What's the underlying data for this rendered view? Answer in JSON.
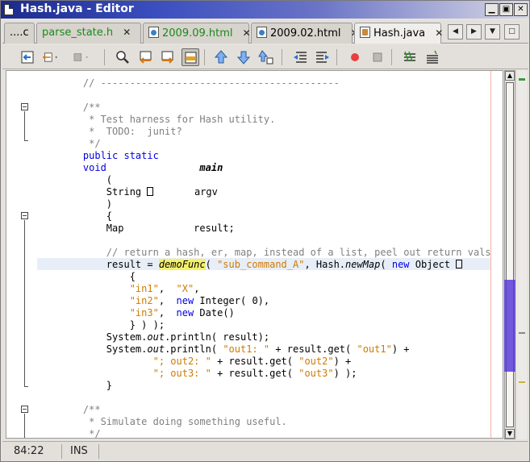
{
  "window": {
    "title": "Hash.java - Editor"
  },
  "window_buttons": [
    "minimize",
    "maximize",
    "close"
  ],
  "tabs": [
    {
      "label": "....c",
      "icon": "none",
      "active": false
    },
    {
      "label": "parse_state.h",
      "icon": "none",
      "active": false,
      "color": "#1a8a1a"
    },
    {
      "label": "2009.09.html",
      "icon": "html-file-icon",
      "active": false,
      "color": "#1a8a1a"
    },
    {
      "label": "2009.02.html",
      "icon": "html-file-icon",
      "active": false
    },
    {
      "label": "Hash.java",
      "icon": "java-file-icon",
      "active": true
    }
  ],
  "tab_close_glyph": "✕",
  "editor": {
    "lines": [
      {
        "parts": [
          {
            "t": "    "
          },
          {
            "c": "cm",
            "t": "// -----------------------------------------"
          }
        ]
      },
      {
        "parts": [
          {
            "t": ""
          }
        ]
      },
      {
        "parts": [
          {
            "t": "    "
          },
          {
            "c": "cm",
            "t": "/**"
          }
        ]
      },
      {
        "parts": [
          {
            "t": "     "
          },
          {
            "c": "cm",
            "t": "* Test harness for Hash utility."
          }
        ]
      },
      {
        "parts": [
          {
            "t": "     "
          },
          {
            "c": "cm",
            "t": "*  TODO:  junit?"
          }
        ]
      },
      {
        "parts": [
          {
            "t": "     "
          },
          {
            "c": "cm",
            "t": "*/"
          }
        ]
      },
      {
        "parts": [
          {
            "t": "    "
          },
          {
            "c": "kw",
            "t": "public static"
          }
        ]
      },
      {
        "parts": [
          {
            "t": "    "
          },
          {
            "c": "kw",
            "t": "void"
          },
          {
            "t": "                "
          },
          {
            "c": "bi",
            "t": "main"
          }
        ]
      },
      {
        "parts": [
          {
            "t": "        ("
          }
        ]
      },
      {
        "parts": [
          {
            "t": "        String "
          },
          {
            "c": "box",
            "t": ""
          },
          {
            "t": "       argv"
          }
        ]
      },
      {
        "parts": [
          {
            "t": "        )"
          }
        ]
      },
      {
        "parts": [
          {
            "t": "        {"
          }
        ]
      },
      {
        "parts": [
          {
            "t": "        Map            result;"
          }
        ]
      },
      {
        "parts": [
          {
            "t": ""
          }
        ]
      },
      {
        "parts": [
          {
            "t": "        "
          },
          {
            "c": "cm",
            "t": "// return a hash, er, map, instead of a list, peel out return vals"
          }
        ]
      },
      {
        "parts": [
          {
            "t": "        result = "
          },
          {
            "c": "hl",
            "t": "demoFunc"
          },
          {
            "t": "( "
          },
          {
            "c": "st",
            "t": "\"sub_command_A\""
          },
          {
            "t": ", Hash."
          },
          {
            "c": "it",
            "t": "newMap"
          },
          {
            "t": "( "
          },
          {
            "c": "kw",
            "t": "new"
          },
          {
            "t": " Object "
          },
          {
            "c": "box",
            "t": ""
          }
        ]
      },
      {
        "parts": [
          {
            "t": "            {"
          }
        ]
      },
      {
        "parts": [
          {
            "t": "            "
          },
          {
            "c": "st",
            "t": "\"in1\""
          },
          {
            "t": ",  "
          },
          {
            "c": "st",
            "t": "\"X\""
          },
          {
            "t": ","
          }
        ]
      },
      {
        "parts": [
          {
            "t": "            "
          },
          {
            "c": "st",
            "t": "\"in2\""
          },
          {
            "t": ",  "
          },
          {
            "c": "kw",
            "t": "new"
          },
          {
            "t": " Integer( 0),"
          }
        ]
      },
      {
        "parts": [
          {
            "t": "            "
          },
          {
            "c": "st",
            "t": "\"in3\""
          },
          {
            "t": ",  "
          },
          {
            "c": "kw",
            "t": "new"
          },
          {
            "t": " Date()"
          }
        ]
      },
      {
        "parts": [
          {
            "t": "            } ) );"
          }
        ]
      },
      {
        "parts": [
          {
            "t": "        System."
          },
          {
            "c": "it",
            "t": "out"
          },
          {
            "t": ".println( result);"
          }
        ]
      },
      {
        "parts": [
          {
            "t": "        System."
          },
          {
            "c": "it",
            "t": "out"
          },
          {
            "t": ".println( "
          },
          {
            "c": "st",
            "t": "\"out1: \""
          },
          {
            "t": " + result.get( "
          },
          {
            "c": "st",
            "t": "\"out1\""
          },
          {
            "t": ") +"
          }
        ]
      },
      {
        "parts": [
          {
            "t": "                "
          },
          {
            "c": "st",
            "t": "\"; out2: \""
          },
          {
            "t": " + result.get( "
          },
          {
            "c": "st",
            "t": "\"out2\""
          },
          {
            "t": ") +"
          }
        ]
      },
      {
        "parts": [
          {
            "t": "                "
          },
          {
            "c": "st",
            "t": "\"; out3: \""
          },
          {
            "t": " + result.get( "
          },
          {
            "c": "st",
            "t": "\"out3\""
          },
          {
            "t": ") );"
          }
        ]
      },
      {
        "parts": [
          {
            "t": "        }"
          }
        ]
      },
      {
        "parts": [
          {
            "t": ""
          }
        ]
      },
      {
        "parts": [
          {
            "t": "    "
          },
          {
            "c": "cm",
            "t": "/**"
          }
        ]
      },
      {
        "parts": [
          {
            "t": "     "
          },
          {
            "c": "cm",
            "t": "* Simulate doing something useful."
          }
        ]
      },
      {
        "parts": [
          {
            "t": "     "
          },
          {
            "c": "cm",
            "t": "*/"
          }
        ]
      }
    ]
  },
  "status": {
    "position": "84:22",
    "mode": "INS"
  },
  "colors": {
    "keyword": "#0000e6",
    "string": "#ce7b00",
    "comment": "#808080",
    "highlight": "#f5f06c",
    "current_line": "#e8eef8",
    "title_bar": "#1c2a8c"
  }
}
